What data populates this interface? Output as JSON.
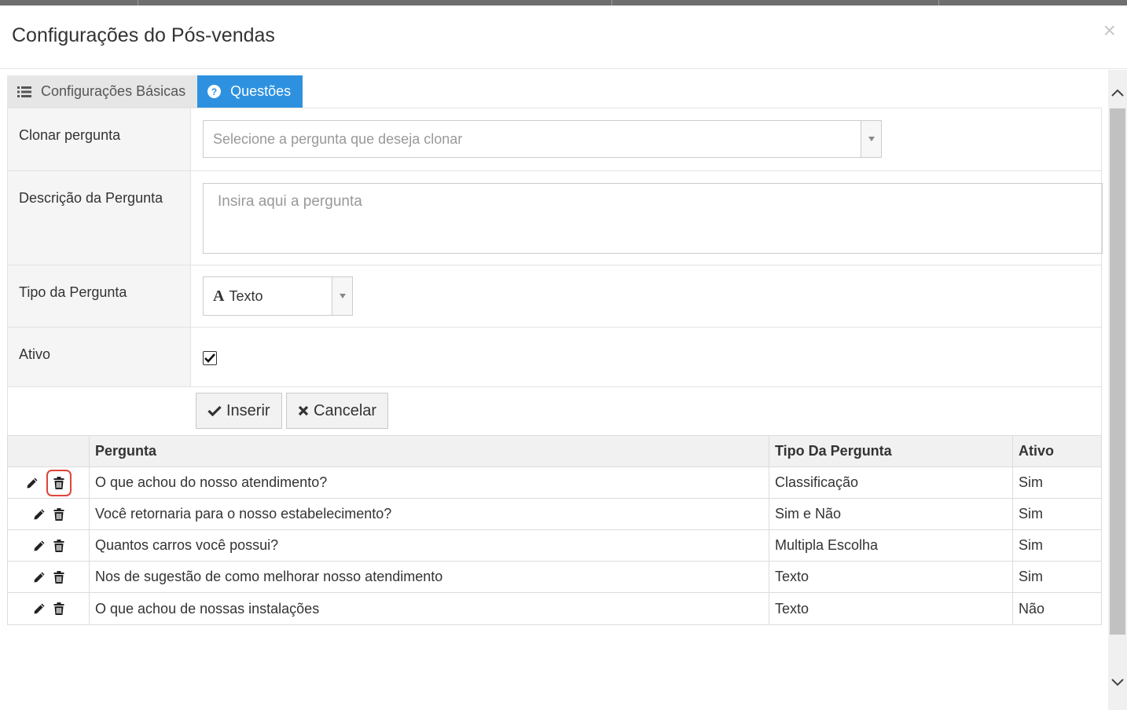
{
  "modal": {
    "title": "Configurações do Pós-vendas",
    "close": "×"
  },
  "tabs": [
    {
      "label": "Configurações Básicas",
      "icon": "list-icon",
      "active": false
    },
    {
      "label": "Questões",
      "icon": "question-circle-icon",
      "active": true
    }
  ],
  "form": {
    "clone": {
      "label": "Clonar pergunta",
      "placeholder": "Selecione a pergunta que deseja clonar"
    },
    "description": {
      "label": "Descrição da Pergunta",
      "placeholder": "Insira aqui a pergunta"
    },
    "type": {
      "label": "Tipo da Pergunta",
      "value": "Texto",
      "icon": "A"
    },
    "active": {
      "label": "Ativo",
      "checked": true
    },
    "buttons": {
      "insert": "Inserir",
      "cancel": "Cancelar"
    }
  },
  "table": {
    "headers": {
      "actions": "",
      "question": "Pergunta",
      "type": "Tipo Da Pergunta",
      "active": "Ativo"
    },
    "rows": [
      {
        "question": "O que achou do nosso atendimento?",
        "type": "Classificação",
        "active": "Sim"
      },
      {
        "question": "Você retornaria para o nosso estabelecimento?",
        "type": "Sim e Não",
        "active": "Sim"
      },
      {
        "question": "Quantos carros você possui?",
        "type": "Multipla Escolha",
        "active": "Sim"
      },
      {
        "question": "Nos de sugestão de como melhorar nosso atendimento",
        "type": "Texto",
        "active": "Sim"
      },
      {
        "question": "O que achou de nossas instalações",
        "type": "Texto",
        "active": "Não"
      }
    ]
  },
  "colors": {
    "tab_active": "#2d91e0",
    "highlight": "#e0443a"
  }
}
